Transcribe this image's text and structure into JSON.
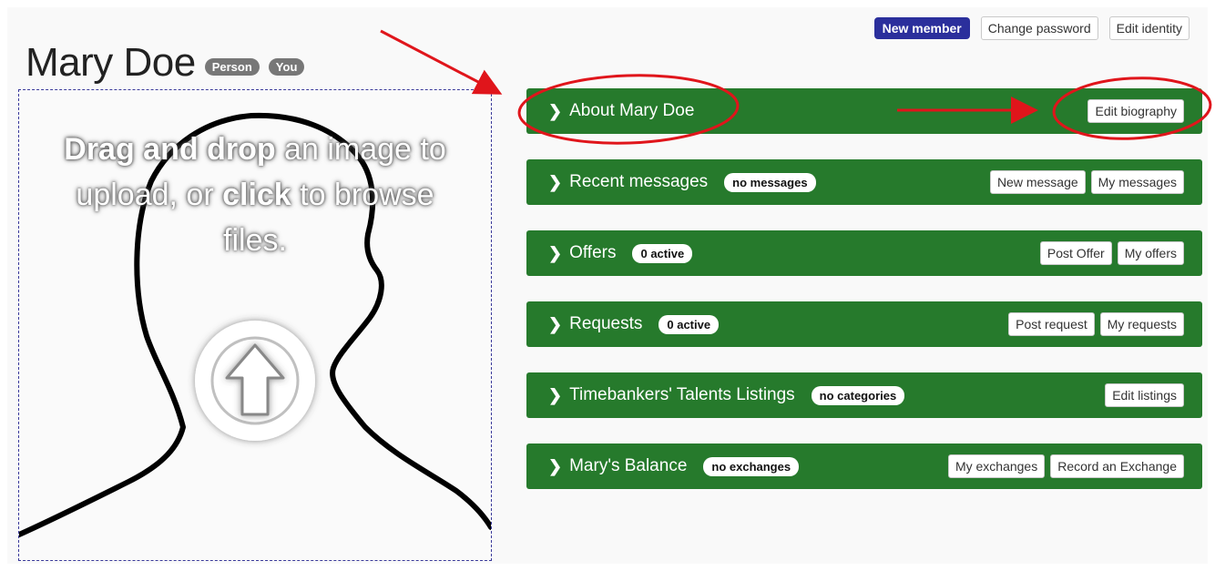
{
  "header": {
    "new_member_label": "New member",
    "change_password_label": "Change password",
    "edit_identity_label": "Edit identity"
  },
  "profile": {
    "name": "Mary Doe",
    "tags": [
      "Person",
      "You"
    ]
  },
  "upload": {
    "strong1": "Drag and drop",
    "text1": " an image to upload, or ",
    "strong2": "click",
    "text2": " to browse files.",
    "icon": "upload-arrow-icon",
    "placeholder_icon": "person-silhouette-icon"
  },
  "panels": [
    {
      "title": "About Mary Doe",
      "badge": "",
      "actions": [
        "Edit biography"
      ]
    },
    {
      "title": "Recent messages",
      "badge": "no messages",
      "actions": [
        "New message",
        "My messages"
      ]
    },
    {
      "title": "Offers",
      "badge": "0 active",
      "actions": [
        "Post Offer",
        "My offers"
      ]
    },
    {
      "title": "Requests",
      "badge": "0 active",
      "actions": [
        "Post request",
        "My requests"
      ]
    },
    {
      "title": "Timebankers' Talents Listings",
      "badge": "no categories",
      "actions": [
        "Edit listings"
      ]
    },
    {
      "title": "Mary's Balance",
      "badge": "no exchanges",
      "actions": [
        "My exchanges",
        "Record an Exchange"
      ]
    }
  ],
  "colors": {
    "panel_green": "#267a2c",
    "new_member_blue": "#2b2f9c",
    "annotation_red": "#e0151b"
  }
}
